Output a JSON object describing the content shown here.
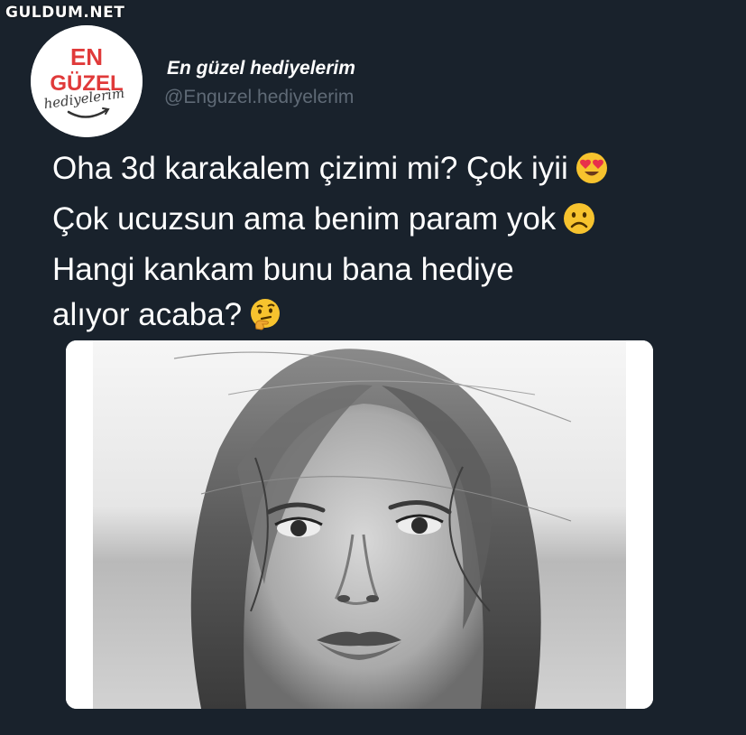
{
  "watermark": "GULDUM.NET",
  "account": {
    "logo_text": [
      "EN",
      "GÜZEL",
      "hediyelerim"
    ],
    "display_name": "En güzel hediyelerim",
    "handle": "@Enguzel.hediyelerim"
  },
  "tweet": {
    "lines": [
      "Oha 3d karakalem çizimi mi? Çok iyii",
      "Çok ucuzsun ama benim param yok",
      "Hangi kankam bunu bana hediye",
      "alıyor acaba?"
    ],
    "emojis": [
      "heart-eyes-emoji",
      "frowning-face-emoji",
      "thinking-face-emoji"
    ]
  },
  "colors": {
    "background": "#19222c",
    "logo_red": "#e03a3a",
    "handle_gray": "#5f6a76"
  }
}
